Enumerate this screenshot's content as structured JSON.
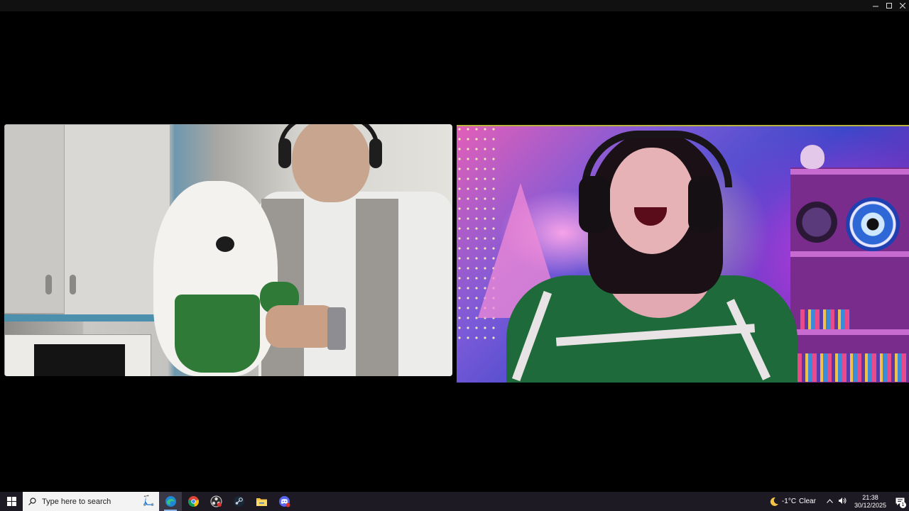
{
  "window": {
    "controls": [
      "minimize-icon",
      "maximize-icon",
      "close-icon"
    ]
  },
  "taskbar": {
    "start_icon": "windows-logo-icon",
    "search_placeholder": "Type here to search",
    "pinned_apps": [
      {
        "name": "edge-icon",
        "active": true
      },
      {
        "name": "chrome-icon",
        "active": false
      },
      {
        "name": "obs-icon",
        "active": false
      },
      {
        "name": "steam-icon",
        "active": false
      },
      {
        "name": "file-explorer-icon",
        "active": false
      },
      {
        "name": "discord-icon",
        "active": false
      }
    ],
    "weather": {
      "icon": "moon-icon",
      "temperature": "-1°C",
      "condition": "Clear"
    },
    "clock": {
      "time": "21:38",
      "date": "30/12/2025"
    },
    "notification_count": "1"
  }
}
